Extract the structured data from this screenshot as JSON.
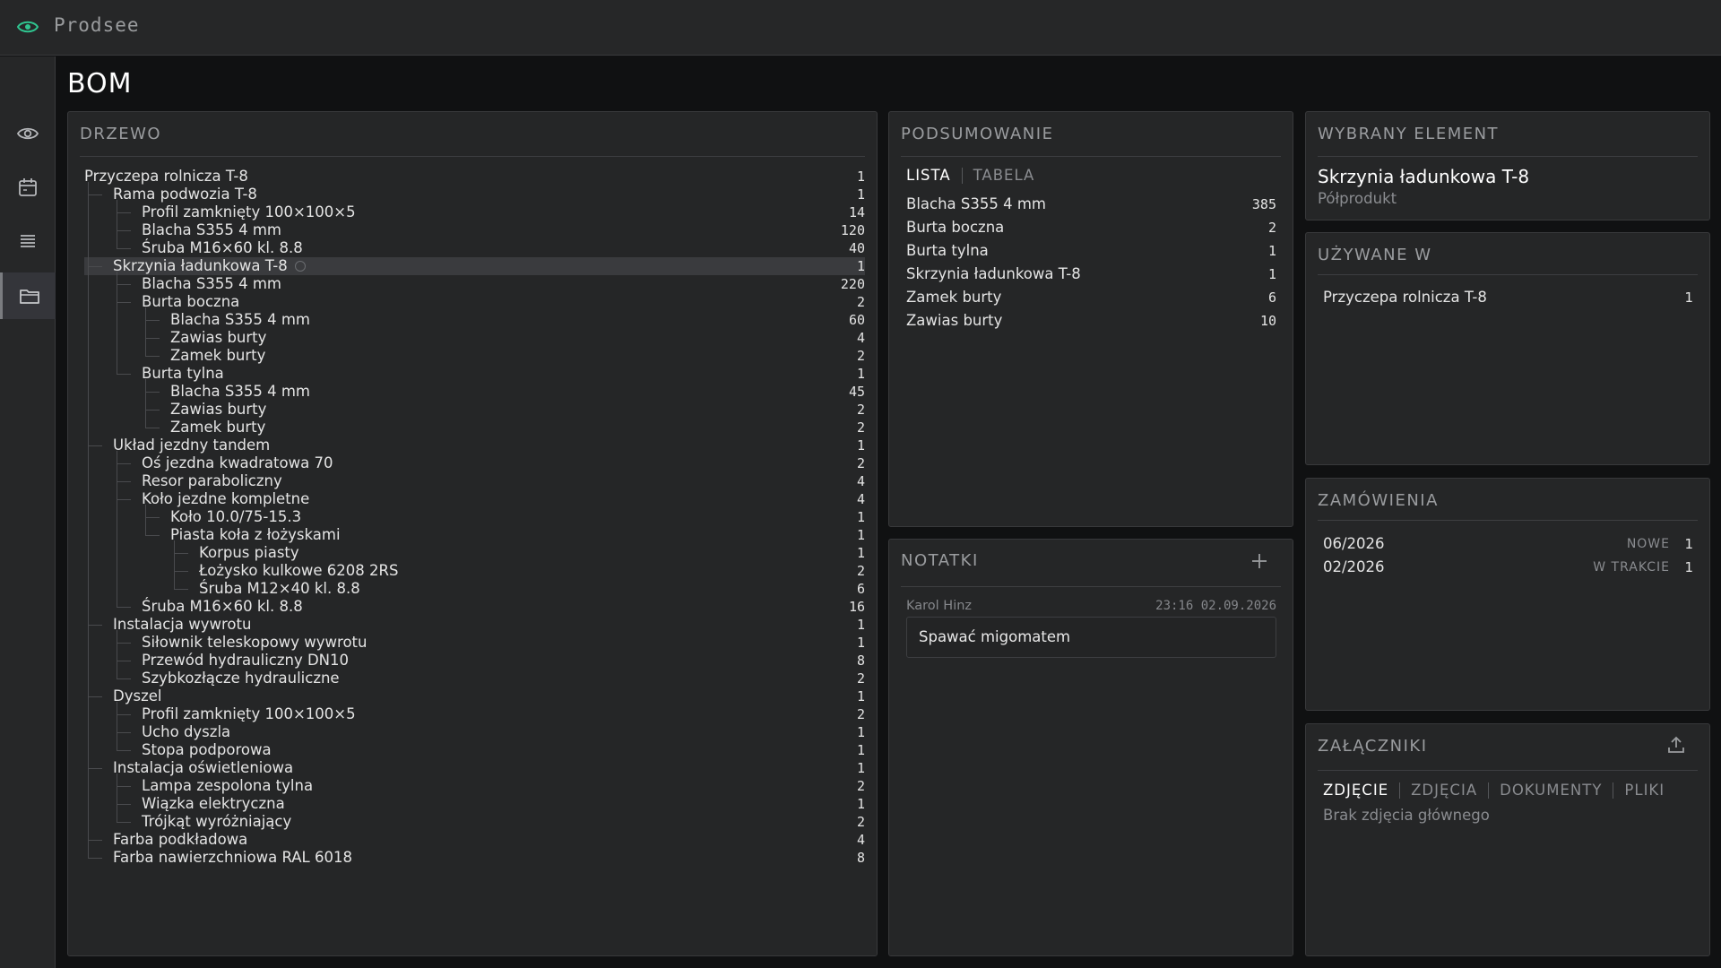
{
  "app": {
    "name": "Prodsee"
  },
  "page": {
    "title": "BOM"
  },
  "sidebar": {
    "items": [
      "eye-icon",
      "calendar-icon",
      "list-icon",
      "folder-icon"
    ]
  },
  "tree": {
    "title": "DRZEWO",
    "rows": [
      {
        "label": "Przyczepa rolnicza T-8",
        "qty": "1",
        "depth": 0
      },
      {
        "label": "Rama podwozia T-8",
        "qty": "1",
        "depth": 1
      },
      {
        "label": "Profil zamknięty 100×100×5",
        "qty": "14",
        "depth": 2
      },
      {
        "label": "Blacha S355 4 mm",
        "qty": "120",
        "depth": 2
      },
      {
        "label": "Śruba M16×60 kl. 8.8",
        "qty": "40",
        "depth": 2
      },
      {
        "label": "Skrzynia ładunkowa T-8",
        "qty": "1",
        "depth": 1,
        "selected": true
      },
      {
        "label": "Blacha S355 4 mm",
        "qty": "220",
        "depth": 2
      },
      {
        "label": "Burta boczna",
        "qty": "2",
        "depth": 2
      },
      {
        "label": "Blacha S355 4 mm",
        "qty": "60",
        "depth": 3
      },
      {
        "label": "Zawias burty",
        "qty": "4",
        "depth": 3
      },
      {
        "label": "Zamek burty",
        "qty": "2",
        "depth": 3
      },
      {
        "label": "Burta tylna",
        "qty": "1",
        "depth": 2
      },
      {
        "label": "Blacha S355 4 mm",
        "qty": "45",
        "depth": 3
      },
      {
        "label": "Zawias burty",
        "qty": "2",
        "depth": 3
      },
      {
        "label": "Zamek burty",
        "qty": "2",
        "depth": 3
      },
      {
        "label": "Układ jezdny tandem",
        "qty": "1",
        "depth": 1
      },
      {
        "label": "Oś jezdna kwadratowa 70",
        "qty": "2",
        "depth": 2
      },
      {
        "label": "Resor paraboliczny",
        "qty": "4",
        "depth": 2
      },
      {
        "label": "Koło jezdne kompletne",
        "qty": "4",
        "depth": 2
      },
      {
        "label": "Koło 10.0/75-15.3",
        "qty": "1",
        "depth": 3
      },
      {
        "label": "Piasta koła z łożyskami",
        "qty": "1",
        "depth": 3
      },
      {
        "label": "Korpus piasty",
        "qty": "1",
        "depth": 4
      },
      {
        "label": "Łożysko kulkowe 6208 2RS",
        "qty": "2",
        "depth": 4
      },
      {
        "label": "Śruba M12×40 kl. 8.8",
        "qty": "6",
        "depth": 4
      },
      {
        "label": "Śruba M16×60 kl. 8.8",
        "qty": "16",
        "depth": 2
      },
      {
        "label": "Instalacja wywrotu",
        "qty": "1",
        "depth": 1
      },
      {
        "label": "Siłownik teleskopowy wywrotu",
        "qty": "1",
        "depth": 2
      },
      {
        "label": "Przewód hydrauliczny DN10",
        "qty": "8",
        "depth": 2
      },
      {
        "label": "Szybkozłącze hydrauliczne",
        "qty": "2",
        "depth": 2
      },
      {
        "label": "Dyszel",
        "qty": "1",
        "depth": 1
      },
      {
        "label": "Profil zamknięty 100×100×5",
        "qty": "2",
        "depth": 2
      },
      {
        "label": "Ucho dyszla",
        "qty": "1",
        "depth": 2
      },
      {
        "label": "Stopa podporowa",
        "qty": "1",
        "depth": 2
      },
      {
        "label": "Instalacja oświetleniowa",
        "qty": "1",
        "depth": 1
      },
      {
        "label": "Lampa zespolona tylna",
        "qty": "2",
        "depth": 2
      },
      {
        "label": "Wiązka elektryczna",
        "qty": "1",
        "depth": 2
      },
      {
        "label": "Trójkąt wyróżniający",
        "qty": "2",
        "depth": 2
      },
      {
        "label": "Farba podkładowa",
        "qty": "4",
        "depth": 1
      },
      {
        "label": "Farba nawierzchniowa RAL 6018",
        "qty": "8",
        "depth": 1
      }
    ]
  },
  "summary": {
    "title": "PODSUMOWANIE",
    "tabs": [
      "LISTA",
      "TABELA"
    ],
    "active_tab": 0,
    "rows": [
      {
        "label": "Blacha S355 4 mm",
        "qty": "385"
      },
      {
        "label": "Burta boczna",
        "qty": "2"
      },
      {
        "label": "Burta tylna",
        "qty": "1"
      },
      {
        "label": "Skrzynia ładunkowa T-8",
        "qty": "1"
      },
      {
        "label": "Zamek burty",
        "qty": "6"
      },
      {
        "label": "Zawias burty",
        "qty": "10"
      }
    ]
  },
  "notes": {
    "title": "NOTATKI",
    "items": [
      {
        "author": "Karol Hinz",
        "time": "23:16 02.09.2026",
        "text": "Spawać migomatem"
      }
    ]
  },
  "selected": {
    "title": "WYBRANY ELEMENT",
    "name": "Skrzynia ładunkowa T-8",
    "type": "Półprodukt"
  },
  "used_in": {
    "title": "UŻYWANE W",
    "rows": [
      {
        "label": "Przyczepa rolnicza T-8",
        "qty": "1"
      }
    ]
  },
  "orders": {
    "title": "ZAMÓWIENIA",
    "rows": [
      {
        "label": "06/2026",
        "status": "NOWE",
        "qty": "1"
      },
      {
        "label": "02/2026",
        "status": "W TRAKCIE",
        "qty": "1"
      }
    ]
  },
  "attachments": {
    "title": "ZAŁĄCZNIKI",
    "tabs": [
      "ZDJĘCIE",
      "ZDJĘCIA",
      "DOKUMENTY",
      "PLIKI"
    ],
    "active_tab": 0,
    "empty_text": "Brak zdjęcia głównego"
  },
  "colors": {
    "accent": "#2fc48f",
    "background": "#101112",
    "panel": "#252627"
  }
}
